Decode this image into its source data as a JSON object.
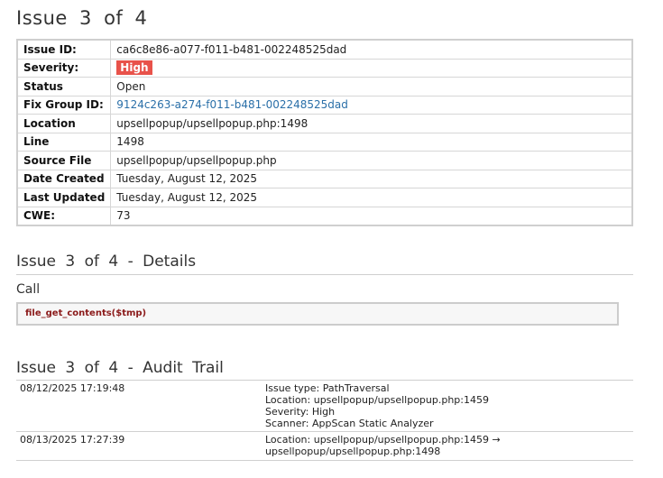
{
  "header": {
    "title_word": "Issue",
    "current": "3",
    "of_word": "of",
    "total": "4"
  },
  "properties": [
    {
      "key": "Issue ID:",
      "value": "ca6c8e86-a077-f011-b481-002248525dad",
      "kind": "text"
    },
    {
      "key": "Severity:",
      "value": "High",
      "kind": "badge"
    },
    {
      "key": "Status",
      "value": "Open",
      "kind": "text"
    },
    {
      "key": "Fix Group ID:",
      "value": "9124c263-a274-f011-b481-002248525dad",
      "kind": "link"
    },
    {
      "key": "Location",
      "value": "upsellpopup/upsellpopup.php:1498",
      "kind": "text"
    },
    {
      "key": "Line",
      "value": "1498",
      "kind": "text"
    },
    {
      "key": "Source File",
      "value": "upsellpopup/upsellpopup.php",
      "kind": "text"
    },
    {
      "key": "Date Created",
      "value": "Tuesday, August 12, 2025",
      "kind": "text"
    },
    {
      "key": "Last Updated",
      "value": "Tuesday, August 12, 2025",
      "kind": "text"
    },
    {
      "key": "CWE:",
      "value": "73",
      "kind": "text"
    }
  ],
  "details": {
    "title": "Issue 3 of 4 - Details",
    "call_label": "Call",
    "call_code": "file_get_contents($tmp)"
  },
  "audit": {
    "title": "Issue 3 of 4 - Audit Trail",
    "entries": [
      {
        "timestamp": "08/12/2025 17:19:48",
        "lines": [
          "Issue type: PathTraversal",
          "Location: upsellpopup/upsellpopup.php:1459",
          "Severity: High",
          "Scanner: AppScan Static Analyzer"
        ]
      },
      {
        "timestamp": "08/13/2025 17:27:39",
        "lines": [
          "Location: upsellpopup/upsellpopup.php:1459 →",
          "upsellpopup/upsellpopup.php:1498"
        ]
      }
    ]
  },
  "colors": {
    "severity_high": "#e8524a",
    "link": "#2a6fa8",
    "code": "#8b1a1a"
  }
}
